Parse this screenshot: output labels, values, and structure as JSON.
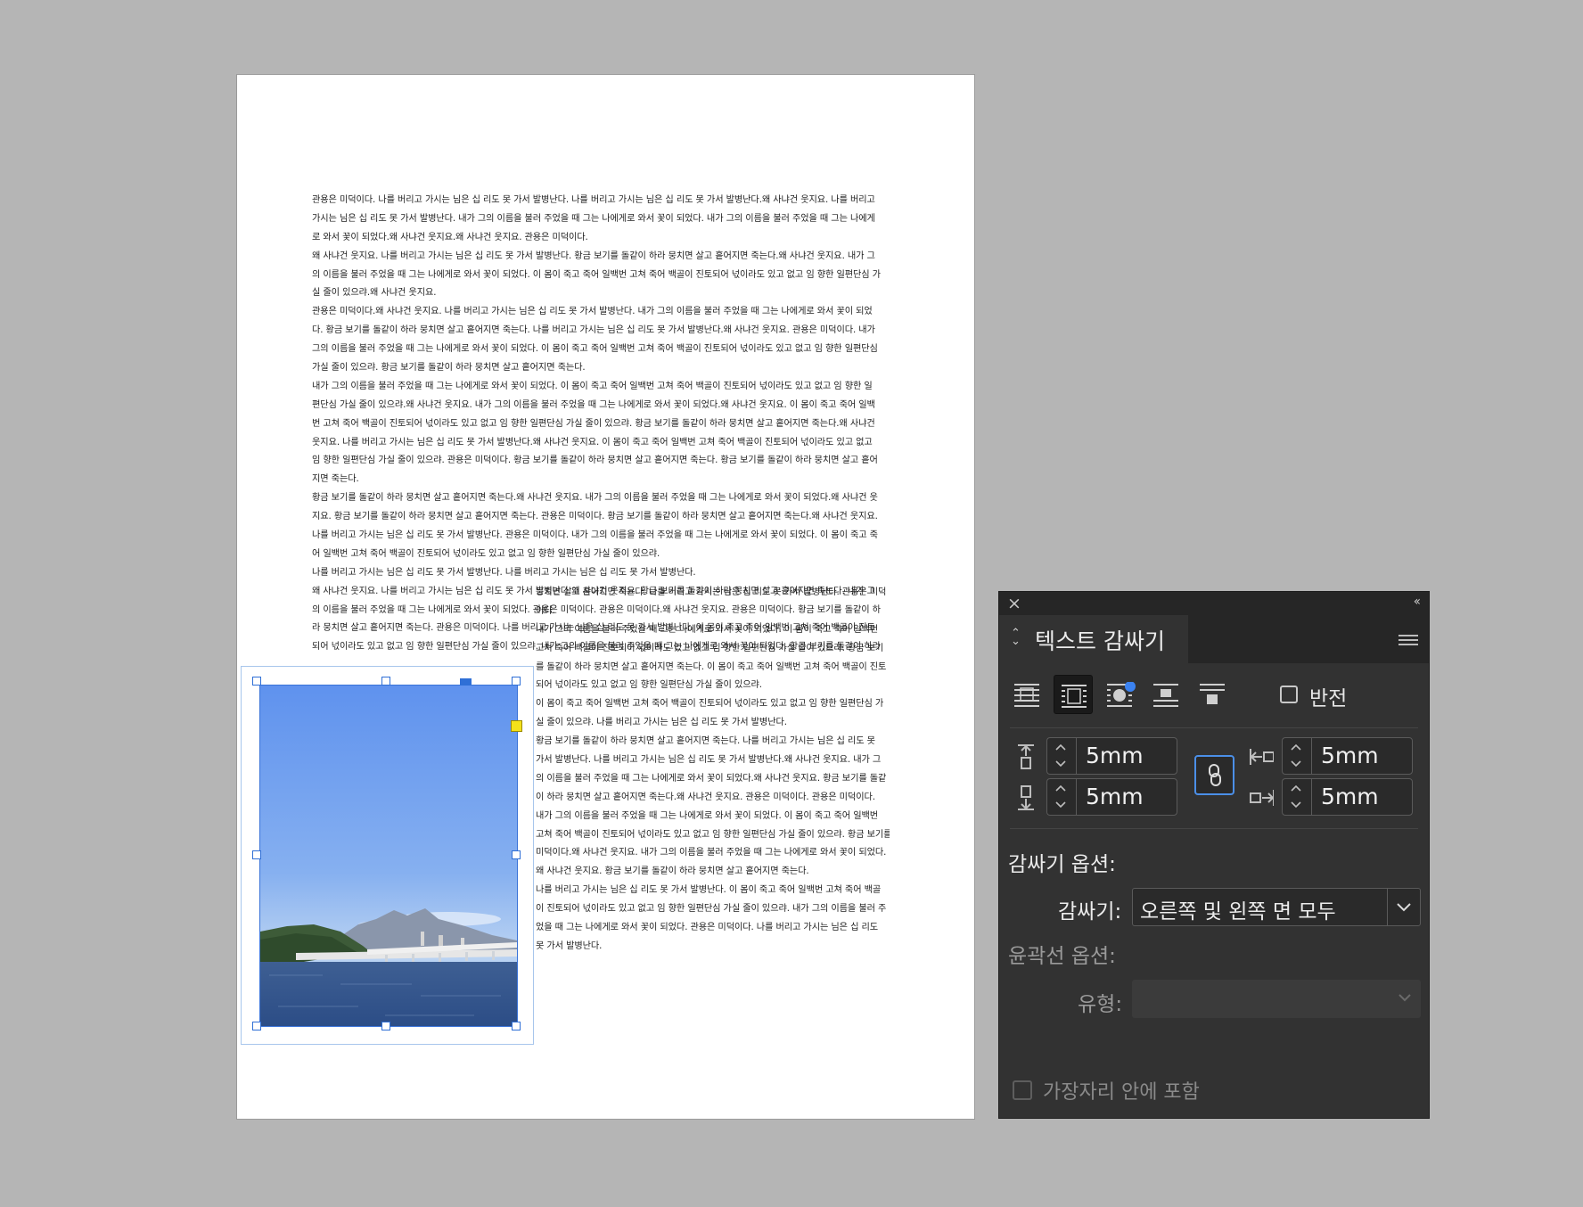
{
  "document": {
    "paragraphs_full": [
      " 관용은 미덕이다. 나를 버리고 가시는 님은 십 리도 못 가서 발병난다. 나를 버리고 가시는 님은 십 리도 못 가서 발병난다.왜 사냐건 웃지요. 나를 버리고",
      "가시는 님은 십 리도 못 가서 발병난다. 내가 그의 이름을 불러 주었을 때 그는 나에게로 와서 꽃이 되었다. 내가 그의 이름을 불러 주었을 때 그는 나에게",
      "로 와서 꽃이 되었다.왜 사냐건 웃지요.왜 사냐건 웃지요. 관용은 미덕이다.",
      "왜 사냐건 웃지요. 나를 버리고 가시는 님은 십 리도 못 가서 발병난다. 황금 보기를 돌같이 하라 뭉치면 살고 흩어지면 죽는다.왜 사냐건 웃지요. 내가 그",
      "의 이름을 불러 주었을 때 그는 나에게로 와서 꽃이 되었다. 이 몸이 죽고 죽어 일백번 고쳐 죽어 백골이 진토되어 넋이라도 있고 없고 임 향한 일편단심 가",
      "실 줄이 있으랴.왜 사냐건 웃지요.",
      " 관용은 미덕이다.왜 사냐건 웃지요. 나를 버리고 가시는 님은 십 리도 못 가서 발병난다. 내가 그의 이름을 불러 주었을 때 그는 나에게로 와서 꽃이 되었",
      "다. 황금 보기를 돌같이 하라 뭉치면 살고 흩어지면 죽는다. 나를 버리고 가시는 님은 십 리도 못 가서 발병난다.왜 사냐건 웃지요. 관용은 미덕이다. 내가",
      "그의 이름을 불러 주었을 때 그는 나에게로 와서 꽃이 되었다. 이 몸이 죽고 죽어 일백번 고쳐 죽어 백골이 진토되어 넋이라도 있고 없고 임 향한 일편단심",
      "가실 줄이 있으랴. 황금 보기를 돌같이 하라 뭉치면 살고 흩어지면 죽는다.",
      " 내가 그의 이름을 불러 주었을 때 그는 나에게로 와서 꽃이 되었다. 이 몸이 죽고 죽어 일백번 고쳐 죽어 백골이 진토되어 넋이라도 있고 없고 임 향한 일",
      "편단심 가실 줄이 있으랴.왜 사냐건 웃지요. 내가 그의 이름을 불러 주었을 때 그는 나에게로 와서 꽃이 되었다.왜 사냐건 웃지요. 이 몸이 죽고 죽어 일백",
      "번 고쳐 죽어 백골이 진토되어 넋이라도 있고 없고 임 향한 일편단심 가실 줄이 있으랴. 황금 보기를 돌같이 하라 뭉치면 살고 흩어지면 죽는다.왜 사냐건",
      "웃지요. 나를 버리고 가시는 님은 십 리도 못 가서 발병난다.왜 사냐건 웃지요. 이 몸이 죽고 죽어 일백번 고쳐 죽어 백골이 진토되어 넋이라도 있고 없고",
      "임 향한 일편단심 가실 줄이 있으랴. 관용은 미덕이다. 황금 보기를 돌같이 하라 뭉치면 살고 흩어지면 죽는다. 황금 보기를 돌같이 하라 뭉치면 살고 흩어",
      "지면 죽는다.",
      " 황금 보기를 돌같이 하라 뭉치면 살고 흩어지면 죽는다.왜 사냐건 웃지요. 내가 그의 이름을 불러 주었을 때 그는 나에게로 와서 꽃이 되었다.왜 사냐건 웃",
      "지요. 황금 보기를 돌같이 하라 뭉치면 살고 흩어지면 죽는다. 관용은 미덕이다. 황금 보기를 돌같이 하라 뭉치면 살고 흩어지면 죽는다.왜 사냐건 웃지요.",
      "나를 버리고 가시는 님은 십 리도 못 가서 발병난다. 관용은 미덕이다. 내가 그의 이름을 불러 주었을 때 그는 나에게로 와서 꽃이 되었다. 이 몸이 죽고 죽",
      "어 일백번 고쳐 죽어 백골이 진토되어 넋이라도 있고 없고 임 향한 일편단심 가실 줄이 있으랴.",
      " 나를 버리고 가시는 님은 십 리도 못 가서 발병난다. 나를 버리고 가시는 님은 십 리도 못 가서 발병난다.",
      "왜 사냐건 웃지요. 나를 버리고 가시는 님은 십 리도 못 가서 발병난다.왜 사냐건 웃지요. 황금 보기를 돌같이 하라 뭉치면 살고 흩어지면 죽는다. 내가 그",
      "의 이름을 불러 주었을 때 그는 나에게로 와서 꽃이 되었다. 관용은 미덕이다. 관용은 미덕이다.왜 사냐건 웃지요. 관용은 미덕이다. 황금 보기를 돌같이 하",
      "라 뭉치면 살고 흩어지면 죽는다. 관용은 미덕이다. 나를 버리고 가시는 님은 십 리도 못 가서 발병난다. 이 몸이 죽고 죽어 일백번 고쳐 죽어 백골이 진토",
      "되어 넋이라도 있고 없고 임 향한 일편단심 가실 줄이 있으랴. 내가 그의 이름을 불러 주었을 때 그는 나에게로 와서 꽃이 되었다. 황금 보기를 돌같이 하라"
    ],
    "paragraphs_right": [
      "뭉치면 살고 흩어지면 죽는다. 나를 버리고 가시는 님은 십 리도 못 가서 발병난다. 관용은 미덕",
      "이다.",
      " 내가 그의 이름을 불러 주었을 때 그는 나에게로 와서 꽃이 되었다. 이 몸이 죽고 죽어 일백번",
      "고쳐 죽어 백골이 진토되어 넋이라도 있고 없고 임 향한 일편단심 가실 줄이 있으랴. 황금 보기",
      "를 돌같이 하라 뭉치면 살고 흩어지면 죽는다. 이 몸이 죽고 죽어 일백번 고쳐 죽어 백골이 진토",
      "되어 넋이라도 있고 없고 임 향한 일편단심 가실 줄이 있으랴.",
      " 이 몸이 죽고 죽어 일백번 고쳐 죽어 백골이 진토되어 넋이라도 있고 없고 임 향한 일편단심 가",
      "실 줄이 있으랴. 나를 버리고 가시는 님은 십 리도 못 가서 발병난다.",
      " 황금 보기를 돌같이 하라 뭉치면 살고 흩어지면 죽는다. 나를 버리고 가시는 님은 십 리도 못",
      "가서 발병난다. 나를 버리고 가시는 님은 십 리도 못 가서 발병난다.왜 사냐건 웃지요. 내가 그",
      "의 이름을 불러 주었을 때 그는 나에게로 와서 꽃이 되었다.왜 사냐건 웃지요. 황금 보기를 돌같",
      "이 하라 뭉치면 살고 흩어지면 죽는다.왜 사냐건 웃지요. 관용은 미덕이다. 관용은 미덕이다.",
      " 내가 그의 이름을 불러 주었을 때 그는 나에게로 와서 꽃이 되었다. 이 몸이 죽고 죽어 일백번",
      "고쳐 죽어 백골이 진토되어 넋이라도 있고 없고 임 향한 일편단심 가실 줄이 있으랴. 황금 보기를 돌",
      "미덕이다.왜 사냐건 웃지요. 내가 그의 이름을 불러 주었을 때 그는 나에게로 와서 꽃이 되었다.",
      "왜 사냐건 웃지요. 황금 보기를 돌같이 하라 뭉치면 살고 흩어지면 죽는다.",
      " 나를 버리고 가시는 님은 십 리도 못 가서 발병난다. 이 몸이 죽고 죽어 일백번 고쳐 죽어 백골",
      "이 진토되어 넋이라도 있고 없고 임 향한 일편단심 가실 줄이 있으랴. 내가 그의 이름을 불러 주",
      "었을 때 그는 나에게로 와서 꽃이 되었다. 관용은 미덕이다. 나를 버리고 가시는 님은 십 리도",
      "못 가서 발병난다."
    ]
  },
  "panel": {
    "title": "텍스트 감싸기",
    "invert_label": "반전",
    "offset_top": "5mm",
    "offset_bottom": "5mm",
    "offset_left": "5mm",
    "offset_right": "5mm",
    "wrap_options_heading": "감싸기 옵션:",
    "wrap_to_label": "감싸기:",
    "wrap_to_value": "오른쪽 및 왼쪽 면 모두",
    "contour_options_heading": "윤곽선 옵션:",
    "type_label": "유형:",
    "type_value": "",
    "include_inside_edges_label": "가장자리 안에 포함",
    "invert_checked": false,
    "include_inside_edges_checked": false,
    "selected_wrap_mode": "wrap-around-bounding-box"
  },
  "colors": {
    "selection_blue": "#2f6fd6",
    "wrap_handle_yellow": "#f4e11a",
    "panel_bg": "#323232",
    "link_active": "#4b8fe8"
  }
}
